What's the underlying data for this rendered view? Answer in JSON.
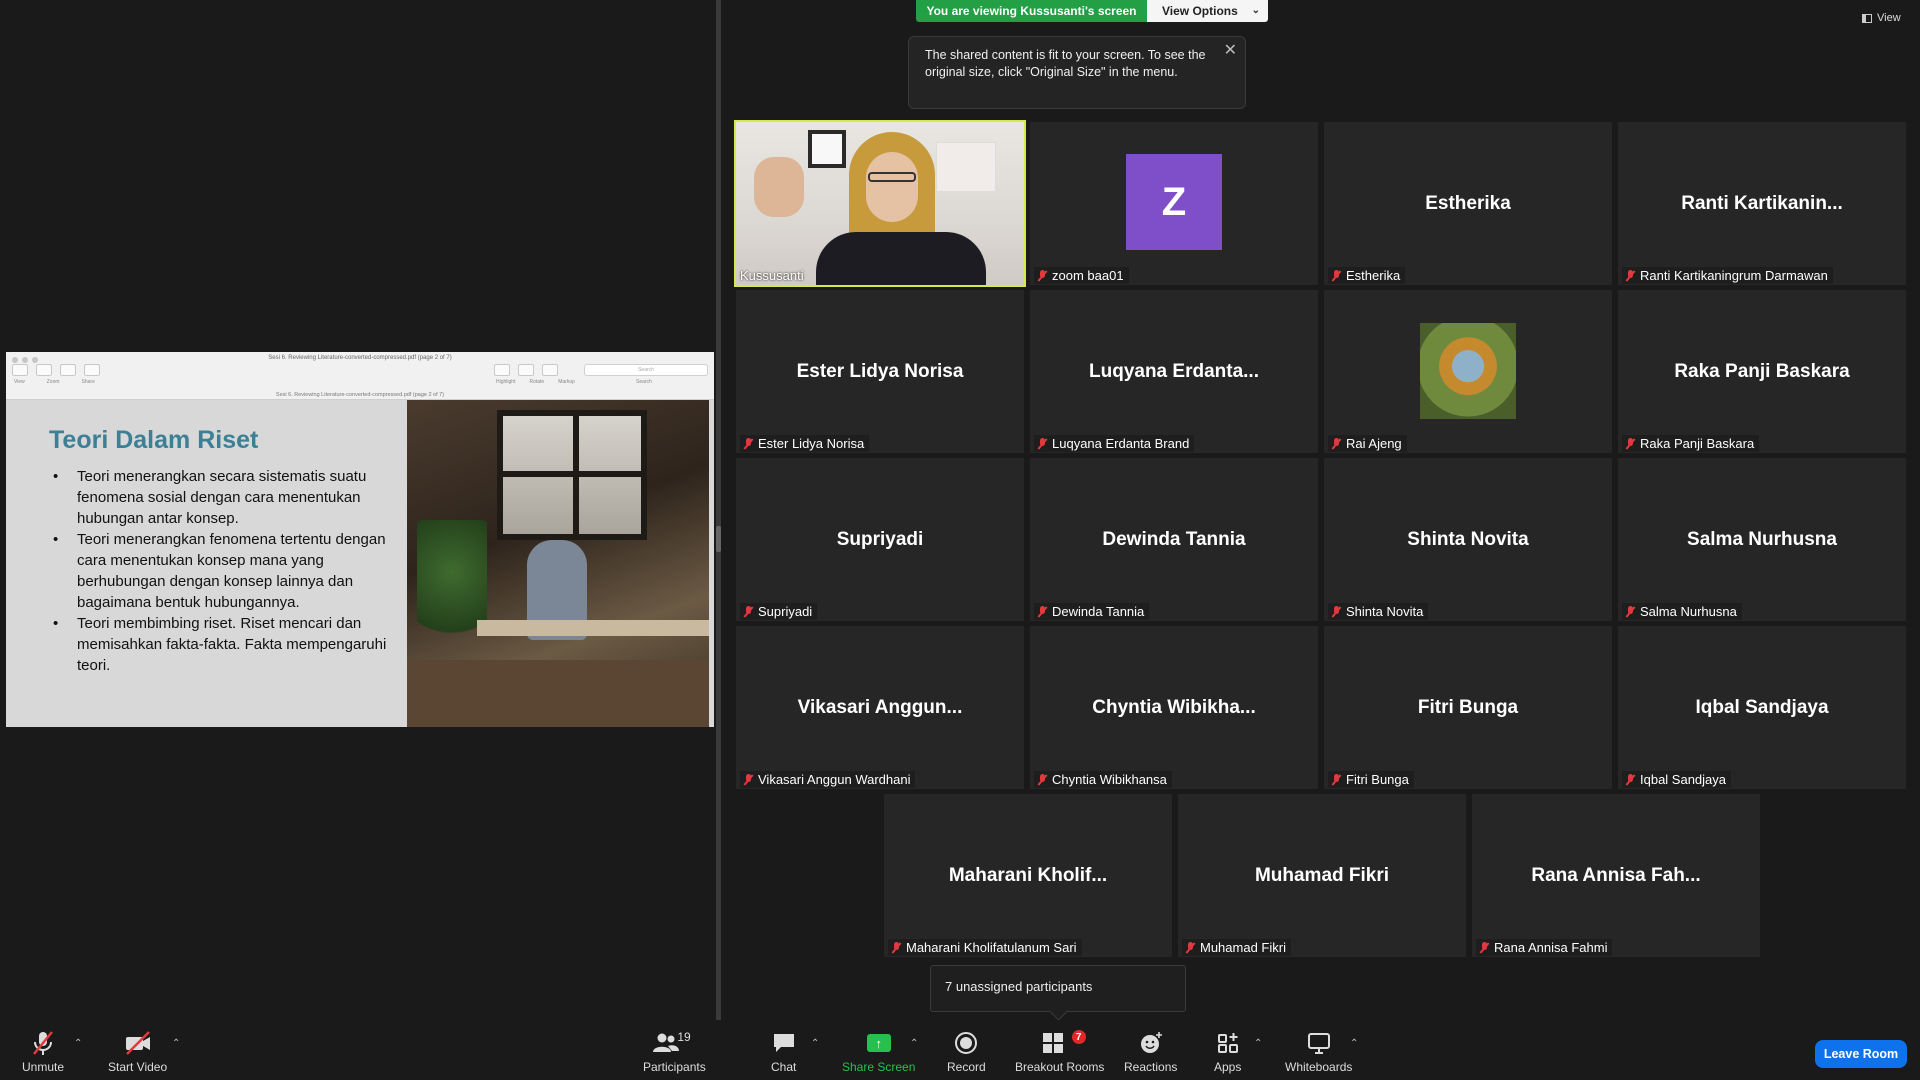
{
  "top": {
    "viewing_text": "You are viewing Kussusanti's screen",
    "view_options_label": "View Options",
    "view_label": "View",
    "tooltip_text": "The shared content is fit to your screen. To see the original size, click \"Original Size\" in the menu."
  },
  "shared": {
    "pdf_title": "Sesi 6. Reviewing Literature-converted-compressed.pdf (page 2 of 7)",
    "pdf_subtitle": "Sesi 6. Reviewing Literature-converted-compressed.pdf (page 2 of 7)",
    "tool_labels": [
      "View",
      "Zoom",
      "Share"
    ],
    "tool_labels_right": [
      "Highlight",
      "Rotate",
      "Markup"
    ],
    "search_placeholder": "Search",
    "search_label": "Search",
    "slide_title": "Teori Dalam Riset",
    "bullets": [
      "Teori menerangkan secara sistematis suatu fenomena sosial dengan cara menentukan hubungan antar konsep.",
      "Teori menerangkan fenomena tertentu dengan cara menentukan konsep mana yang berhubungan dengan konsep lainnya dan bagaimana bentuk hubungannya.",
      "Teori membimbing riset. Riset mencari dan memisahkan fakta-fakta. Fakta mempengaruhi teori."
    ]
  },
  "participants": [
    {
      "big": "",
      "label": "Kussusanti",
      "kind": "video"
    },
    {
      "big": "Z",
      "label": "zoom baa01",
      "kind": "avatar"
    },
    {
      "big": "Estherika",
      "label": "Estherika",
      "kind": "name"
    },
    {
      "big": "Ranti  Kartikanin...",
      "label": "Ranti Kartikaningrum Darmawan",
      "kind": "name"
    },
    {
      "big": "Ester Lidya Norisa",
      "label": "Ester Lidya Norisa",
      "kind": "name"
    },
    {
      "big": "Luqyana  Erdanta...",
      "label": "Luqyana Erdanta Brand",
      "kind": "name"
    },
    {
      "big": "",
      "label": "Rai Ajeng",
      "kind": "photo"
    },
    {
      "big": "Raka Panji Baskara",
      "label": "Raka Panji Baskara",
      "kind": "name"
    },
    {
      "big": "Supriyadi",
      "label": "Supriyadi",
      "kind": "name"
    },
    {
      "big": "Dewinda Tannia",
      "label": "Dewinda Tannia",
      "kind": "name"
    },
    {
      "big": "Shinta Novita",
      "label": "Shinta Novita",
      "kind": "name"
    },
    {
      "big": "Salma Nurhusna",
      "label": "Salma Nurhusna",
      "kind": "name"
    },
    {
      "big": "Vikasari  Anggun...",
      "label": "Vikasari Anggun Wardhani",
      "kind": "name"
    },
    {
      "big": "Chyntia  Wibikha...",
      "label": "Chyntia Wibikhansa",
      "kind": "name"
    },
    {
      "big": "Fitri Bunga",
      "label": "Fitri Bunga",
      "kind": "name"
    },
    {
      "big": "Iqbal Sandjaya",
      "label": "Iqbal Sandjaya",
      "kind": "name"
    },
    {
      "big": "Maharani  Kholif...",
      "label": "Maharani Kholifatulanum Sari",
      "kind": "name"
    },
    {
      "big": "Muhamad Fikri",
      "label": "Muhamad Fikri",
      "kind": "name"
    },
    {
      "big": "Rana Annisa  Fah...",
      "label": "Rana Annisa Fahmi",
      "kind": "name"
    }
  ],
  "unassigned_text": "7 unassigned participants",
  "toolbar": {
    "unmute": "Unmute",
    "start_video": "Start Video",
    "participants": "Participants",
    "participants_count": "19",
    "chat": "Chat",
    "share_screen": "Share Screen",
    "record": "Record",
    "breakout_rooms": "Breakout Rooms",
    "breakout_badge": "7",
    "reactions": "Reactions",
    "apps": "Apps",
    "whiteboards": "Whiteboards",
    "leave_room": "Leave Room"
  },
  "colors": {
    "accent_green": "#23a045",
    "active_speaker": "#d4e94a",
    "leave_blue": "#0e72ed",
    "muted_red": "#e03a3e"
  }
}
